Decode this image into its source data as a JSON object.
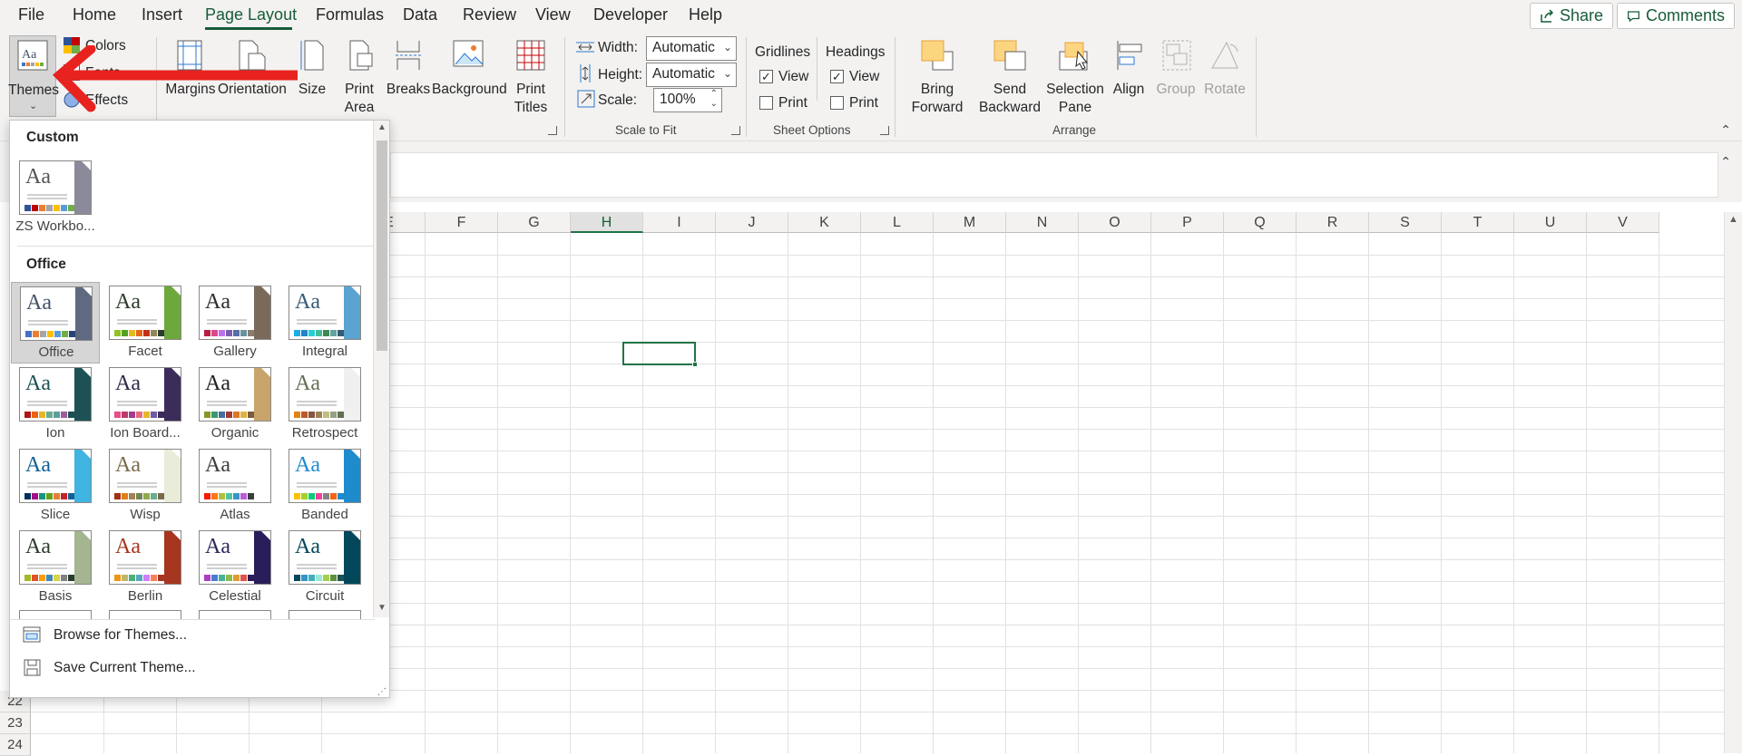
{
  "menu": {
    "tabs": [
      "File",
      "Home",
      "Insert",
      "Page Layout",
      "Formulas",
      "Data",
      "Review",
      "View",
      "Developer",
      "Help"
    ],
    "active_tab": "Page Layout",
    "share_label": "Share",
    "comments_label": "Comments"
  },
  "ribbon": {
    "themes_group": {
      "themes_label": "Themes",
      "colors_label": "Colors",
      "fonts_label": "Fonts",
      "effects_label": "Effects"
    },
    "page_setup": {
      "margins": "Margins",
      "orientation": "Orientation",
      "size": "Size",
      "print_area": [
        "Print",
        "Area"
      ],
      "breaks": "Breaks",
      "background": "Background",
      "print_titles": [
        "Print",
        "Titles"
      ]
    },
    "scale_to_fit": {
      "group_label": "Scale to Fit",
      "width_label": "Width:",
      "width_value": "Automatic",
      "height_label": "Height:",
      "height_value": "Automatic",
      "scale_label": "Scale:",
      "scale_value": "100%"
    },
    "sheet_options": {
      "group_label": "Sheet Options",
      "gridlines": "Gridlines",
      "headings": "Headings",
      "view": "View",
      "print": "Print",
      "gridlines_view_checked": true,
      "gridlines_print_checked": false,
      "headings_view_checked": true,
      "headings_print_checked": false
    },
    "arrange": {
      "group_label": "Arrange",
      "bring_forward": [
        "Bring",
        "Forward"
      ],
      "send_backward": [
        "Send",
        "Backward"
      ],
      "selection_pane": [
        "Selection",
        "Pane"
      ],
      "align": "Align",
      "group": "Group",
      "rotate": "Rotate"
    }
  },
  "grid": {
    "columns": [
      "E",
      "F",
      "G",
      "H",
      "I",
      "J",
      "K",
      "L",
      "M",
      "N",
      "O",
      "P",
      "Q",
      "R",
      "S",
      "T",
      "U",
      "V"
    ],
    "selected_column": "H",
    "rows": [
      "22",
      "23",
      "24"
    ]
  },
  "themes_panel": {
    "custom_label": "Custom",
    "custom_themes": [
      {
        "name": "ZS Workbo...",
        "text_color": "#555555",
        "side_color": "#8a8a9a",
        "swatches": [
          "#2f5496",
          "#c00000",
          "#ed7d31",
          "#a5a5a5",
          "#ffc000",
          "#5b9bd5",
          "#70ad47"
        ]
      }
    ],
    "office_label": "Office",
    "office_themes": [
      {
        "name": "Office",
        "text_color": "#44546a",
        "side_color": "#5f6a80",
        "swatches": [
          "#4472c4",
          "#ed7d31",
          "#a5a5a5",
          "#ffc000",
          "#5b9bd5",
          "#70ad47",
          "#264478"
        ],
        "selected": true
      },
      {
        "name": "Facet",
        "text_color": "#2c3c2c",
        "side_color": "#6ca83c",
        "swatches": [
          "#90c226",
          "#54a021",
          "#e6b91e",
          "#e76618",
          "#c42f1a",
          "#918655",
          "#2c3c2c"
        ]
      },
      {
        "name": "Gallery",
        "text_color": "#2d2d2d",
        "side_color": "#7a6a5a",
        "swatches": [
          "#b71e42",
          "#de478e",
          "#bc72f0",
          "#795faf",
          "#586ea6",
          "#6892a0",
          "#8a7d6e"
        ]
      },
      {
        "name": "Integral",
        "text_color": "#335b74",
        "side_color": "#5ba3d0",
        "swatches": [
          "#1cade4",
          "#2683c6",
          "#27ced7",
          "#42ba97",
          "#3e8853",
          "#62a39f",
          "#335b74"
        ]
      },
      {
        "name": "Ion",
        "text_color": "#1e5155",
        "side_color": "#1e5155",
        "swatches": [
          "#b01513",
          "#ea6312",
          "#e6b729",
          "#6aac90",
          "#5f9c9d",
          "#9e5e9b",
          "#1e5155"
        ]
      },
      {
        "name": "Ion Board...",
        "text_color": "#2c2c4a",
        "side_color": "#3c2c5a",
        "swatches": [
          "#e84c8b",
          "#b83d68",
          "#a53c8c",
          "#e66c7d",
          "#e6b729",
          "#6e5ca4",
          "#3c2c5a"
        ]
      },
      {
        "name": "Organic",
        "text_color": "#212121",
        "side_color": "#c8a46a",
        "swatches": [
          "#83992a",
          "#3c9770",
          "#44709d",
          "#a23c33",
          "#d97828",
          "#deb340",
          "#7a5c3e"
        ]
      },
      {
        "name": "Retrospect",
        "text_color": "#637052",
        "side_color": "#f0f0f0",
        "swatches": [
          "#e48312",
          "#bd582c",
          "#865640",
          "#9b8357",
          "#c2bc80",
          "#94a088",
          "#637052"
        ]
      },
      {
        "name": "Slice",
        "text_color": "#146194",
        "side_color": "#3fb4e0",
        "swatches": [
          "#052f61",
          "#a50e82",
          "#14967c",
          "#6a9e1f",
          "#e87d37",
          "#c62324",
          "#146194"
        ]
      },
      {
        "name": "Wisp",
        "text_color": "#7a6a4a",
        "side_color": "#e8ecd8",
        "swatches": [
          "#a53010",
          "#de7e18",
          "#9f8351",
          "#728653",
          "#92aa4c",
          "#6aac91",
          "#7a6a4a"
        ]
      },
      {
        "name": "Atlas",
        "text_color": "#3c3c3c",
        "side_color": "#ffffff",
        "swatches": [
          "#f81b02",
          "#fc7715",
          "#afbf41",
          "#50c49f",
          "#3b95c4",
          "#b560d4",
          "#3c3c3c"
        ]
      },
      {
        "name": "Banded",
        "text_color": "#1e8bcd",
        "side_color": "#1e8bcd",
        "swatches": [
          "#ffc000",
          "#a5d028",
          "#08cc78",
          "#f24099",
          "#828288",
          "#f56617",
          "#1e8bcd"
        ]
      },
      {
        "name": "Basis",
        "text_color": "#2c3c2c",
        "side_color": "#a5b592",
        "swatches": [
          "#a6b727",
          "#df5327",
          "#fe9e00",
          "#418ab3",
          "#d7d447",
          "#818183",
          "#2c3c2c"
        ]
      },
      {
        "name": "Berlin",
        "text_color": "#a6361f",
        "side_color": "#a6361f",
        "swatches": [
          "#f09415",
          "#c1b56b",
          "#4baf73",
          "#5aa6c0",
          "#d17df9",
          "#fa7e5c",
          "#a6361f"
        ]
      },
      {
        "name": "Celestial",
        "text_color": "#2a2a5a",
        "side_color": "#2a1e5a",
        "swatches": [
          "#ac3ec1",
          "#477bd1",
          "#46b298",
          "#90ba4c",
          "#dd9d31",
          "#e25247",
          "#2a1e5a"
        ]
      },
      {
        "name": "Circuit",
        "text_color": "#03485a",
        "side_color": "#03485a",
        "swatches": [
          "#03485a",
          "#3394c6",
          "#41aebd",
          "#97e9d5",
          "#a2cf49",
          "#608f3d",
          "#1e5155"
        ]
      }
    ],
    "browse_label": "Browse for Themes...",
    "save_label": "Save Current Theme..."
  },
  "annotation_color": "#e8231f"
}
